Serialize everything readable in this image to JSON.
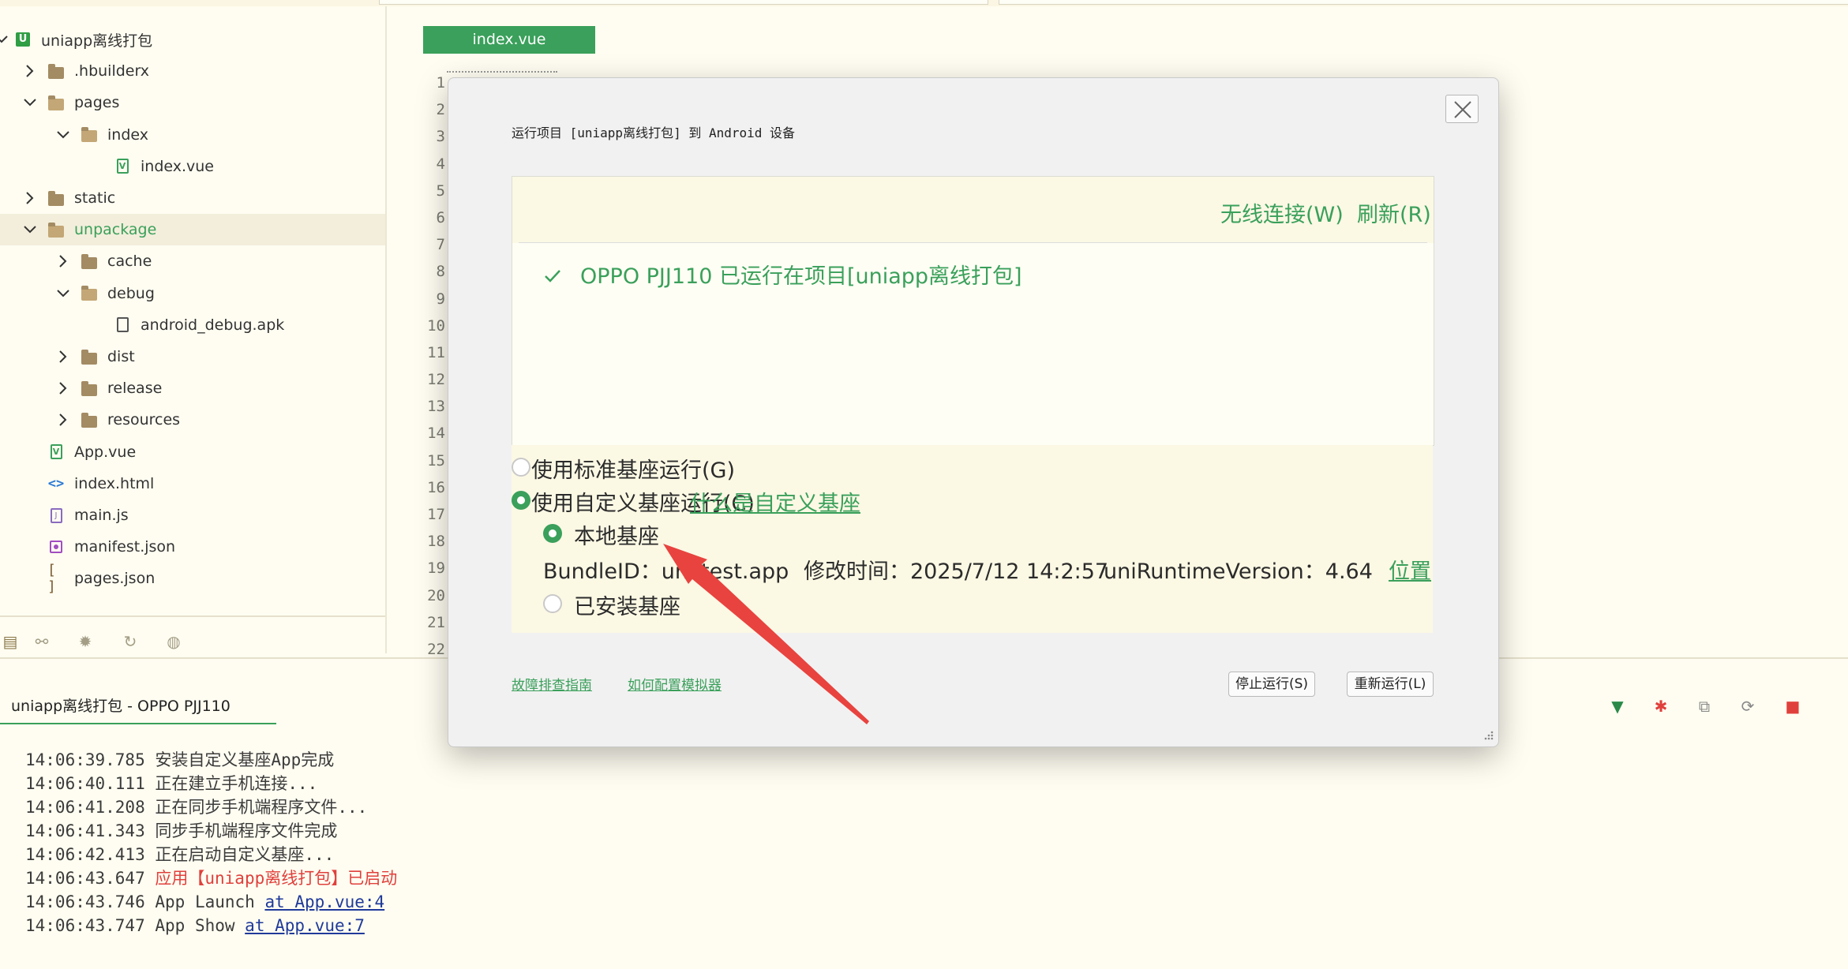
{
  "sidebar": {
    "items": [
      {
        "label": "uniapp离线打包",
        "icon": "uniapp-project-icon",
        "chevron": "down"
      },
      {
        "label": ".hbuilderx",
        "icon": "folder-icon",
        "chevron": "right"
      },
      {
        "label": "pages",
        "icon": "folder-open-icon",
        "chevron": "down"
      },
      {
        "label": "index",
        "icon": "folder-open-icon",
        "chevron": "down"
      },
      {
        "label": "index.vue",
        "icon": "vue-file-icon",
        "chevron": ""
      },
      {
        "label": "static",
        "icon": "folder-icon",
        "chevron": "right"
      },
      {
        "label": "unpackage",
        "icon": "folder-open-icon",
        "chevron": "down"
      },
      {
        "label": "cache",
        "icon": "folder-icon",
        "chevron": "right"
      },
      {
        "label": "debug",
        "icon": "folder-open-icon",
        "chevron": "down"
      },
      {
        "label": "android_debug.apk",
        "icon": "file-icon",
        "chevron": ""
      },
      {
        "label": "dist",
        "icon": "folder-icon",
        "chevron": "right"
      },
      {
        "label": "release",
        "icon": "folder-icon",
        "chevron": "right"
      },
      {
        "label": "resources",
        "icon": "folder-icon",
        "chevron": "right"
      },
      {
        "label": "App.vue",
        "icon": "vue-file-icon",
        "chevron": ""
      },
      {
        "label": "index.html",
        "icon": "html-file-icon",
        "chevron": ""
      },
      {
        "label": "main.js",
        "icon": "js-file-icon",
        "chevron": ""
      },
      {
        "label": "manifest.json",
        "icon": "manifest-file-icon",
        "chevron": ""
      },
      {
        "label": "pages.json",
        "icon": "json-file-icon",
        "chevron": ""
      }
    ],
    "tools": [
      "project-icon",
      "binoculars-icon",
      "bug-icon",
      "history-icon",
      "plugin-icon"
    ]
  },
  "editor": {
    "tab_label": "index.vue",
    "line_numbers": [
      "1",
      "2",
      "3",
      "4",
      "5",
      "6",
      "7",
      "8",
      "9",
      "10",
      "11",
      "12",
      "13",
      "14",
      "15",
      "16",
      "17",
      "18",
      "19",
      "20",
      "21",
      "22"
    ]
  },
  "console": {
    "tab_label": "uniapp离线打包 - OPPO PJJ110",
    "icons": [
      "vue-icon",
      "debug-icon",
      "open-external-icon",
      "restart-icon",
      "stop-icon"
    ],
    "lines": [
      {
        "time": "14:06:39.785",
        "text": "安装自定义基座App完成",
        "link": ""
      },
      {
        "time": "14:06:40.111",
        "text": "正在建立手机连接...",
        "link": ""
      },
      {
        "time": "14:06:41.208",
        "text": "正在同步手机端程序文件...",
        "link": ""
      },
      {
        "time": "14:06:41.343",
        "text": "同步手机端程序文件完成",
        "link": ""
      },
      {
        "time": "14:06:42.413",
        "text": "正在启动自定义基座...",
        "link": ""
      },
      {
        "time": "14:06:43.647",
        "text": "应用【uniapp离线打包】已启动",
        "link": ""
      },
      {
        "time": "14:06:43.746",
        "text": "App Launch ",
        "link": "at App.vue:4"
      },
      {
        "time": "14:06:43.747",
        "text": "App Show ",
        "link": "at App.vue:7"
      }
    ]
  },
  "dialog": {
    "title": "运行项目 [uniapp离线打包] 到 Android 设备",
    "wireless_link": "无线连接(W)",
    "refresh_link": "刷新(R)",
    "device": "OPPO PJJ110 已运行在项目[uniapp离线打包]",
    "options": {
      "standard": "使用标准基座运行(G)",
      "custom": "使用自定义基座运行(C)",
      "custom_help": "什么是自定义基座",
      "local": "本地基座",
      "installed": "已安装基座"
    },
    "info": {
      "bundle": "BundleID：uni.test.app",
      "modified": "修改时间：2025/7/12 14:2:57",
      "runtime": "uniRuntimeVersion：4.64",
      "location_link": "位置"
    },
    "footer": {
      "troubleshoot_link": "故障排查指南",
      "emulator_link": "如何配置模拟器",
      "stop_button": "停止运行(S)",
      "rerun_button": "重新运行(L)"
    }
  },
  "colors": {
    "accent": "#3aa05b",
    "arrow": "#e8433f",
    "error_text": "#e0403c",
    "background": "#fffdf1"
  }
}
